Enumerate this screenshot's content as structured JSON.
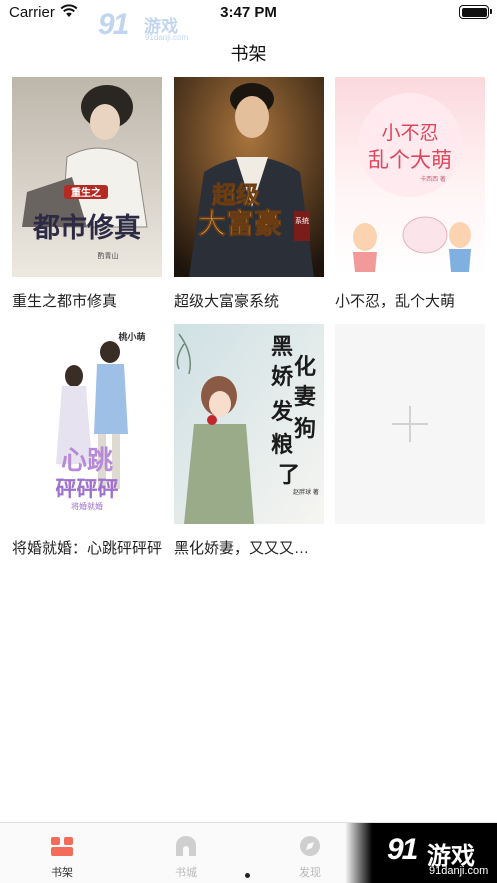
{
  "status_bar": {
    "carrier": "Carrier",
    "time": "3:47 PM"
  },
  "watermark": {
    "logo_number": "91",
    "logo_text": "游戏",
    "url": "91danji.com"
  },
  "nav": {
    "title": "书架"
  },
  "books": [
    {
      "title": "重生之都市修真",
      "cover_text": [
        "重生之",
        "都市修真",
        "酌青山"
      ],
      "cover_colors": [
        "#c9c2b8",
        "#e9e5dc"
      ]
    },
    {
      "title": "超级大富豪系统",
      "cover_text": [
        "超级",
        "大富豪",
        "系统"
      ],
      "cover_colors": [
        "#2a1d12",
        "#a9743c"
      ]
    },
    {
      "title": "小不忍，乱个大萌",
      "cover_text": [
        "小不忍",
        "乱个大萌",
        "卡西西 著"
      ],
      "cover_colors": [
        "#fde3e6",
        "#ffffff"
      ]
    },
    {
      "title": "将婚就婚：心跳砰砰砰",
      "cover_text": [
        "桃小萌",
        "心跳",
        "砰砰砰",
        "将婚就婚"
      ],
      "cover_colors": [
        "#ffffff",
        "#f3f0f8"
      ]
    },
    {
      "title": "黑化娇妻，又又又发狗粮了",
      "cover_text": [
        "黑",
        "化",
        "娇",
        "妻",
        "发",
        "狗",
        "粮",
        "了",
        "赵胖球 著"
      ],
      "cover_colors": [
        "#dde9ec",
        "#f4f4f1"
      ]
    }
  ],
  "add_book": {
    "icon": "plus-icon"
  },
  "tabs": [
    {
      "label": "书架",
      "icon": "bookshelf-icon",
      "active": true
    },
    {
      "label": "书城",
      "icon": "bookstore-icon",
      "active": false
    },
    {
      "label": "发现",
      "icon": "discover-icon",
      "active": false
    }
  ],
  "colors": {
    "accent": "#f26b5b",
    "tab_inactive": "#b8b8b8"
  }
}
